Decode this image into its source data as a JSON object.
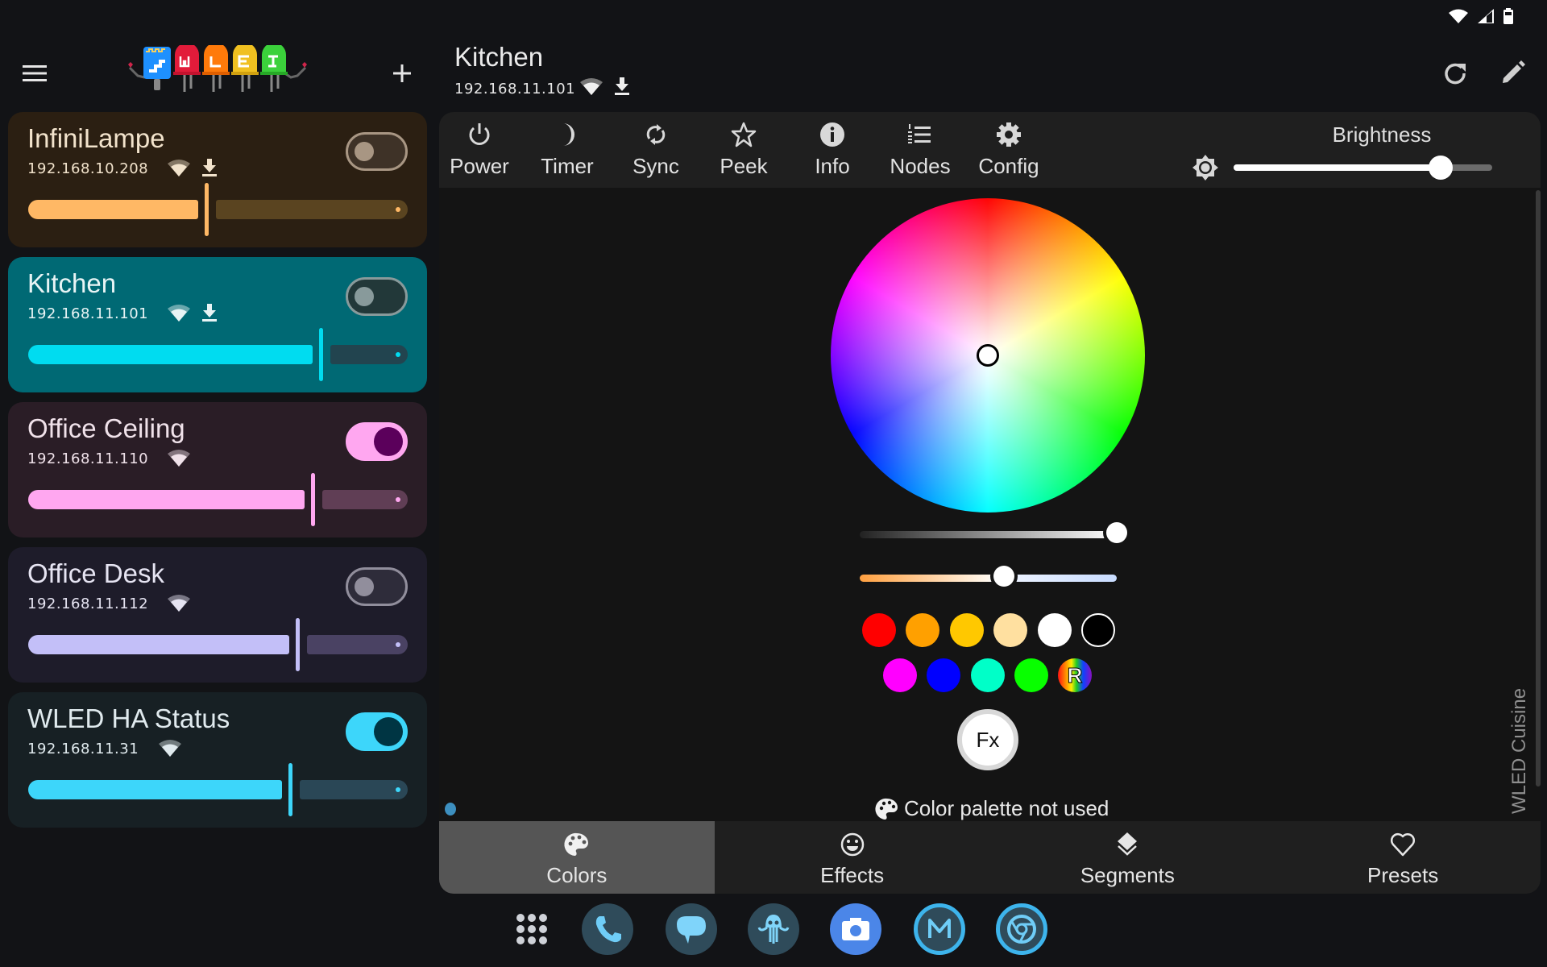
{
  "status_bar": {
    "icons": [
      "wifi-icon",
      "cellular-signal-icon",
      "battery-icon"
    ]
  },
  "sidebar": {
    "menu_icon": "hamburger-menu-icon",
    "logo_text": "WLED",
    "add_icon": "plus-icon",
    "devices": [
      {
        "name": "InfiniLampe",
        "ip": "192.168.10.208",
        "on": false,
        "brightness": 0.47,
        "has_update": true,
        "selected": false,
        "colors": {
          "card": "#2b1f12",
          "text": "#f2e3cc",
          "fill": "#ffb865",
          "rest": "#5a4420",
          "toggle_track": "#3e3227",
          "toggle_border": "#a89683",
          "knob": "#a89683"
        }
      },
      {
        "name": "Kitchen",
        "ip": "192.168.11.101",
        "on": false,
        "brightness": 0.77,
        "has_update": true,
        "selected": true,
        "colors": {
          "card": "#006974",
          "text": "#e8f4f5",
          "fill": "#00dcf0",
          "rest": "#22444f",
          "toggle_track": "#223839",
          "toggle_border": "#889a9b",
          "knob": "#889a9b"
        }
      },
      {
        "name": "Office Ceiling",
        "ip": "192.168.11.110",
        "on": true,
        "brightness": 0.75,
        "has_update": false,
        "selected": false,
        "colors": {
          "card": "#2a1d26",
          "text": "#f0e2ea",
          "fill": "#ffa7f0",
          "rest": "#603e55",
          "toggle_track": "#ffa7f0",
          "toggle_border": "#ffa7f0",
          "knob": "#5b005b"
        }
      },
      {
        "name": "Office Desk",
        "ip": "192.168.11.112",
        "on": false,
        "brightness": 0.71,
        "has_update": false,
        "selected": false,
        "colors": {
          "card": "#1e1c2a",
          "text": "#e6e4f2",
          "fill": "#c3bff8",
          "rest": "#4a4263",
          "toggle_track": "#2e2c3a",
          "toggle_border": "#918e9c",
          "knob": "#918e9c"
        }
      },
      {
        "name": "WLED HA Status",
        "ip": "192.168.11.31",
        "on": true,
        "brightness": 0.69,
        "has_update": false,
        "selected": false,
        "colors": {
          "card": "#172024",
          "text": "#e0eaee",
          "fill": "#3dd6fa",
          "rest": "#2a4756",
          "toggle_track": "#3dd6fa",
          "toggle_border": "#3dd6fa",
          "knob": "#003543"
        }
      }
    ]
  },
  "header": {
    "title": "Kitchen",
    "ip": "192.168.11.101",
    "refresh_icon": "refresh-icon",
    "edit_icon": "pencil-icon"
  },
  "toolbar": {
    "items": [
      {
        "label": "Power",
        "icon": "power-icon"
      },
      {
        "label": "Timer",
        "icon": "moon-icon"
      },
      {
        "label": "Sync",
        "icon": "sync-icon"
      },
      {
        "label": "Peek",
        "icon": "star-icon"
      },
      {
        "label": "Info",
        "icon": "info-icon"
      },
      {
        "label": "Nodes",
        "icon": "numbered-list-icon"
      },
      {
        "label": "Config",
        "icon": "gear-icon"
      }
    ],
    "brightness_label": "Brightness",
    "brightness_value": 0.8
  },
  "color_picker": {
    "wheel_cursor": {
      "hue_deg": 0,
      "saturation": 0
    },
    "white_level": 1.0,
    "cct": 0.56,
    "swatches_row1": [
      "#ff0000",
      "#ffa000",
      "#ffc800",
      "#ffe0a0",
      "#ffffff",
      "#000000"
    ],
    "swatches_row2": [
      "#ff00ff",
      "#0000ff",
      "#00ffc8",
      "#08ff00"
    ],
    "random_label": "R",
    "fx_label": "Fx",
    "palette_note": "Color palette not used",
    "side_label": "WLED Cuisine"
  },
  "tabs": [
    {
      "label": "Colors",
      "icon": "palette-icon",
      "active": true
    },
    {
      "label": "Effects",
      "icon": "smiley-icon",
      "active": false
    },
    {
      "label": "Segments",
      "icon": "layers-icon",
      "active": false
    },
    {
      "label": "Presets",
      "icon": "heart-icon",
      "active": false
    }
  ],
  "dock": [
    {
      "name": "app-drawer",
      "icon": "grid-icon"
    },
    {
      "name": "phone",
      "icon": "phone-icon"
    },
    {
      "name": "messages",
      "icon": "chat-bubble-icon"
    },
    {
      "name": "octopus-app",
      "icon": "octopus-icon"
    },
    {
      "name": "camera",
      "icon": "camera-icon"
    },
    {
      "name": "m-app",
      "icon": "m-letter-icon"
    },
    {
      "name": "chrome",
      "icon": "chrome-icon"
    }
  ]
}
